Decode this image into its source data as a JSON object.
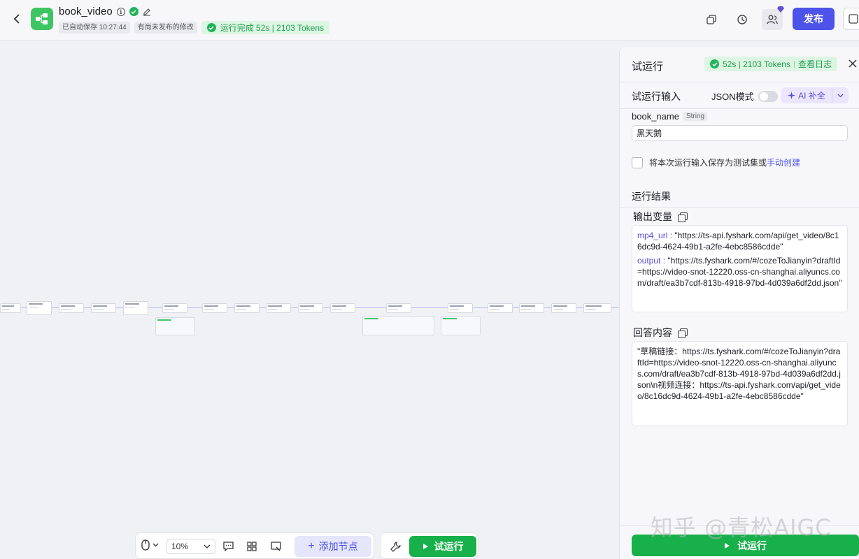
{
  "header": {
    "title": "book_video",
    "autosave": "已自动保存 10:27:44",
    "unpublished": "有尚未发布的修改",
    "run_status": "运行完成 52s | 2103 Tokens",
    "publish_label": "发布"
  },
  "canvas": {
    "zoom": "10%",
    "add_node_label": "添加节点",
    "run_label": "试运行"
  },
  "panel": {
    "title": "试运行",
    "status": "52s | 2103 Tokens",
    "view_log": "查看日志",
    "input_section": "试运行输入",
    "json_mode_label": "JSON模式",
    "ai_fill_label": "AI 补全",
    "field": {
      "name": "book_name",
      "type": "String",
      "value": "黑天鹅"
    },
    "save_as_test_text": "将本次运行输入保存为测试集或",
    "manual_create_link": "手动创建",
    "result_section": "运行结果",
    "output_vars_label": "输出变量",
    "outputs": [
      {
        "key": "mp4_url",
        "value": "\"https://ts-api.fyshark.com/api/get_video/8c16dc9d-4624-49b1-a2fe-4ebc8586cdde\""
      },
      {
        "key": "output",
        "value": "\"https://ts.fyshark.com/#/cozeToJianyin?draftId=https://video-snot-12220.oss-cn-shanghai.aliyuncs.com/draft/ea3b7cdf-813b-4918-97bd-4d039a6df2dd.json\""
      }
    ],
    "answer_label": "回答内容",
    "answer_text": "\"草稿链接：https://ts.fyshark.com/#/cozeToJianyin?draftId=https://video-snot-12220.oss-cn-shanghai.aliyuncs.com/draft/ea3b7cdf-813b-4918-97bd-4d039a6df2dd.json\\n视频连接：https://ts-api.fyshark.com/api/get_video/8c16dc9d-4624-49b1-a2fe-4ebc8586cdde\"",
    "run_button": "试运行"
  },
  "watermark": "知乎 @青松AIGC",
  "colors": {
    "accent": "#4d53e8",
    "success": "#18b04a",
    "success_bg": "#ddf5e3"
  },
  "icons": [
    "back-arrow-icon",
    "workflow-logo-icon",
    "info-icon",
    "verified-icon",
    "edit-icon",
    "copy-window-icon",
    "history-icon",
    "users-icon",
    "close-icon",
    "copy-icon",
    "mouse-icon",
    "comment-icon",
    "layout-icon",
    "minimap-icon",
    "wrench-icon",
    "play-icon",
    "sparkle-icon"
  ]
}
